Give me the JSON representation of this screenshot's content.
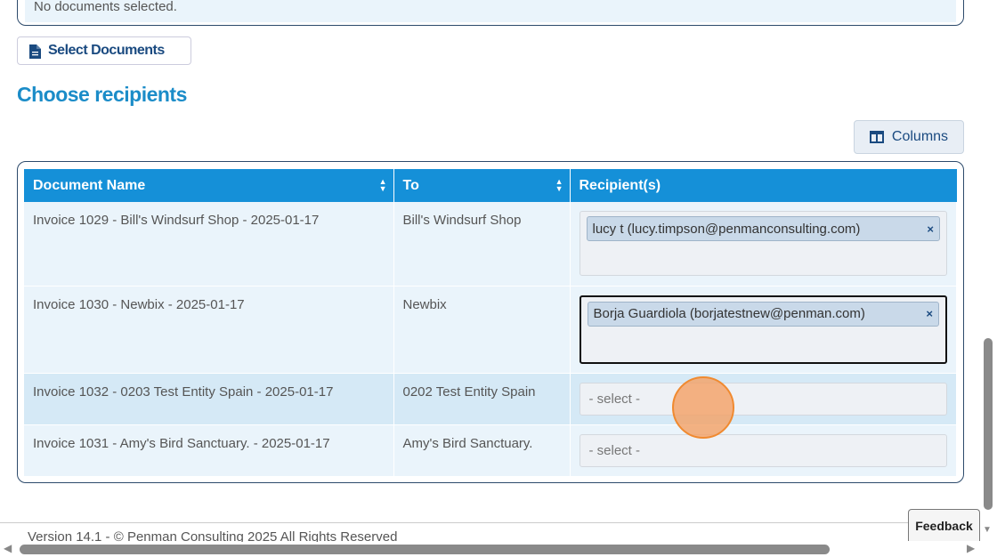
{
  "documents": {
    "empty_text": "No documents selected.",
    "select_button": "Select Documents"
  },
  "recipients": {
    "title": "Choose recipients",
    "columns_button": "Columns",
    "headers": [
      "Document Name",
      "To",
      "Recipient(s)"
    ],
    "rows": [
      {
        "name": "Invoice 1029 - Bill's Windsurf Shop - 2025-01-17",
        "to": "Bill's Windsurf Shop",
        "recipient": "lucy t (lucy.timpson@penmanconsulting.com)"
      },
      {
        "name": "Invoice 1030 - Newbix - 2025-01-17",
        "to": "Newbix",
        "recipient": "Borja Guardiola (borjatestnew@penman.com)"
      },
      {
        "name": "Invoice 1032 - 0203 Test Entity Spain - 2025-01-17",
        "to": "0202 Test Entity Spain",
        "placeholder": "- select -"
      },
      {
        "name": "Invoice 1031 - Amy's Bird Sanctuary. - 2025-01-17",
        "to": "Amy's Bird Sanctuary.",
        "placeholder": "- select -"
      }
    ],
    "remove_glyph": "×"
  },
  "footer": {
    "text": "Version 14.1 - © Penman Consulting 2025 All Rights Reserved",
    "feedback": "Feedback"
  },
  "colors": {
    "accent": "#1590d8",
    "heading": "#1b8cc8",
    "dark_blue": "#1a4a80"
  }
}
